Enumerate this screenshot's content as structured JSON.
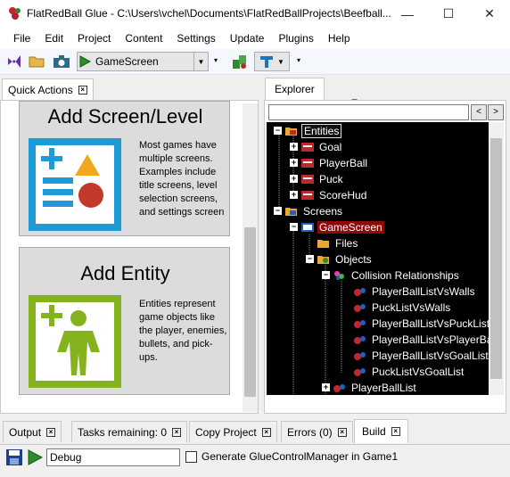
{
  "window": {
    "title": "FlatRedBall Glue - C:\\Users\\vchel\\Documents\\FlatRedBallProjects\\Beefball...",
    "minimize_glyph": "—",
    "maximize_glyph": "☐",
    "close_glyph": "✕"
  },
  "menu": [
    "File",
    "Edit",
    "Project",
    "Content",
    "Settings",
    "Update",
    "Plugins",
    "Help"
  ],
  "toolbar": {
    "selected_screen": "GameScreen",
    "icons": [
      "visual-studio-icon",
      "open-folder-icon",
      "camera-icon",
      "play-icon",
      "glue-icon",
      "tool-icon"
    ]
  },
  "quick_actions": {
    "tab_label": "Quick Actions",
    "cards": [
      {
        "title": "Add Screen/Level",
        "description": [
          "Most games have",
          "multiple screens.",
          "Examples include",
          "title screens, level",
          "selection screens,",
          "and settings screen"
        ]
      },
      {
        "title": "Add Entity",
        "description": [
          "Entities represent",
          "game objects like",
          "the player, enemies,",
          "bullets, and pick-",
          "ups."
        ]
      }
    ]
  },
  "explorer": {
    "tab_label": "Explorer",
    "back_glyph": "<",
    "forward_glyph": ">",
    "tree": [
      {
        "label": "Entities",
        "expander": "−"
      },
      {
        "label": "Goal",
        "expander": "+"
      },
      {
        "label": "PlayerBall",
        "expander": "+"
      },
      {
        "label": "Puck",
        "expander": "+"
      },
      {
        "label": "ScoreHud",
        "expander": "+"
      },
      {
        "label": "Screens",
        "expander": "−"
      },
      {
        "label": "GameScreen",
        "expander": "−"
      },
      {
        "label": "Files",
        "expander": ""
      },
      {
        "label": "Objects",
        "expander": "−"
      },
      {
        "label": "Collision Relationships",
        "expander": "−"
      },
      {
        "label": "PlayerBallListVsWalls",
        "expander": ""
      },
      {
        "label": "PuckListVsWalls",
        "expander": ""
      },
      {
        "label": "PlayerBallListVsPuckList",
        "expander": ""
      },
      {
        "label": "PlayerBallListVsPlayerBal",
        "expander": ""
      },
      {
        "label": "PlayerBallListVsGoalList",
        "expander": ""
      },
      {
        "label": "PuckListVsGoalList",
        "expander": ""
      },
      {
        "label": "PlayerBallList",
        "expander": "+"
      }
    ]
  },
  "bottom_tabs": [
    "Output",
    "Tasks remaining: 0",
    "Copy Project",
    "Errors (0)",
    "Build"
  ],
  "build": {
    "configuration": "Debug",
    "generate_label": "Generate GlueControlManager in Game1",
    "generate_checked": false
  },
  "colors": {
    "selected_node_bg": "#8b0a0a",
    "tree_bg": "#000000",
    "card_icon_screen": "#1e9bd7",
    "card_icon_entity": "#84b31f"
  }
}
